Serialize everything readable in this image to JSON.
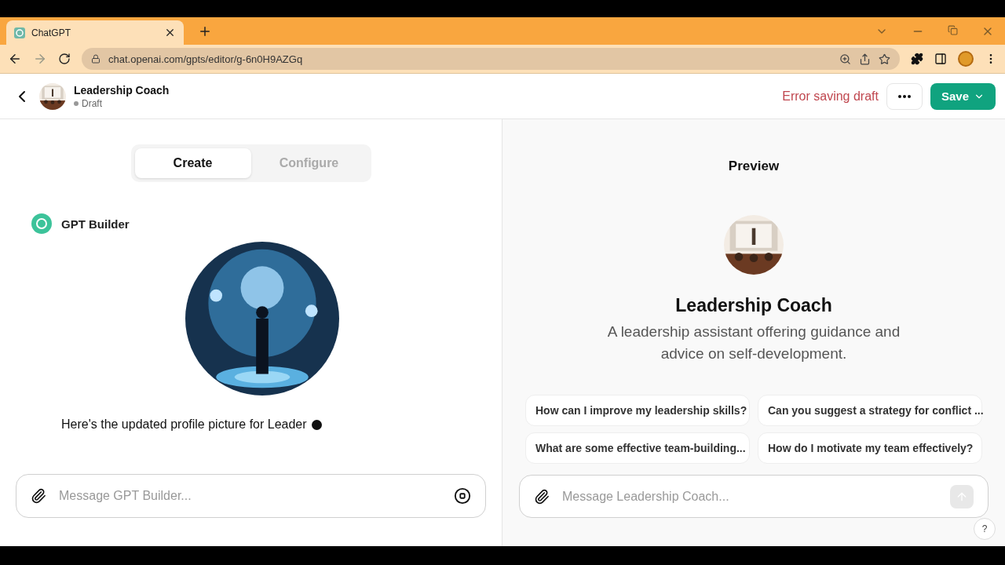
{
  "browser": {
    "tab_title": "ChatGPT",
    "url": "chat.openai.com/gpts/editor/g-6n0H9AZGq"
  },
  "header": {
    "title": "Leadership Coach",
    "status": "Draft",
    "error": "Error saving draft",
    "save_label": "Save"
  },
  "tabs": [
    {
      "label": "Create",
      "selected": true
    },
    {
      "label": "Configure",
      "selected": false
    }
  ],
  "builder": {
    "name": "GPT Builder",
    "message": "Here's the updated profile picture for Leader",
    "placeholder": "Message GPT Builder..."
  },
  "preview": {
    "heading": "Preview",
    "name": "Leadership Coach",
    "description": "A leadership assistant offering guidance and advice on self-development.",
    "suggestions": [
      "How can I improve my leadership skills?",
      "Can you suggest a strategy for conflict ...",
      "What are some effective team-building...",
      "How do I motivate my team effectively?"
    ],
    "placeholder": "Message Leadership Coach..."
  },
  "help": "?"
}
